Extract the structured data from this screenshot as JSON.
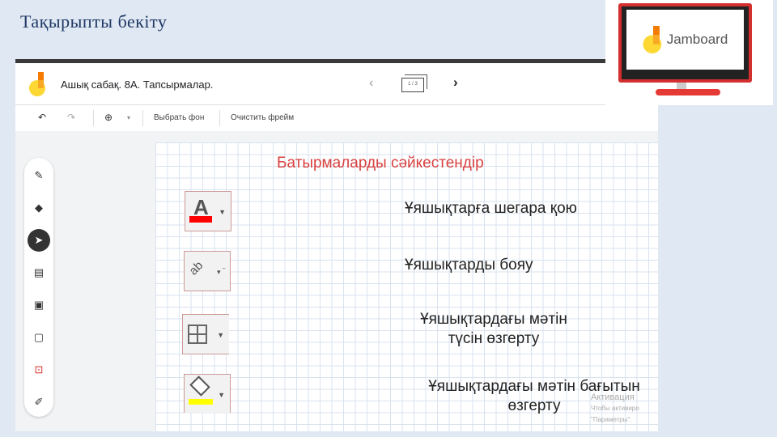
{
  "slide": {
    "title": "Тақырыпты бекіту"
  },
  "app": {
    "doc_title": "Ашық сабақ. 8А. Тапсырмалар.",
    "frame_counter": "1 / 3",
    "prev_icon": "chevron-left-icon",
    "next_icon": "chevron-right-icon"
  },
  "toolbar": {
    "undo": "↶",
    "redo": "↷",
    "zoom": "⊕",
    "zoom_dd": "▾",
    "set_background": "Выбрать фон",
    "clear_frame": "Очистить фрейм"
  },
  "palette": {
    "tools": [
      "pen",
      "eraser",
      "select",
      "sticky-note",
      "image",
      "shape",
      "text-box",
      "laser"
    ]
  },
  "canvas": {
    "heading": "Батырмаларды сәйкестендір",
    "buttons": [
      {
        "icon": "font-color-icon",
        "color": "#ff0000"
      },
      {
        "icon": "text-orientation-icon"
      },
      {
        "icon": "borders-icon"
      },
      {
        "icon": "fill-color-icon",
        "color": "#ffff00"
      }
    ],
    "labels": [
      "Ұяшықтарға шегара қою",
      "Ұяшықтарды бояу",
      "Ұяшықтардағы мәтін\nтүсін өзгерту",
      "Ұяшықтардағы мәтін бағытын\nөзгерту"
    ]
  },
  "watermark": {
    "line1": "Активация",
    "line2": "Чтобы активиро",
    "line3": "\"Параметры\"."
  },
  "logo": {
    "text": "Jamboard"
  },
  "colors": {
    "accent": "#d94040",
    "background": "#dfe8f3"
  }
}
